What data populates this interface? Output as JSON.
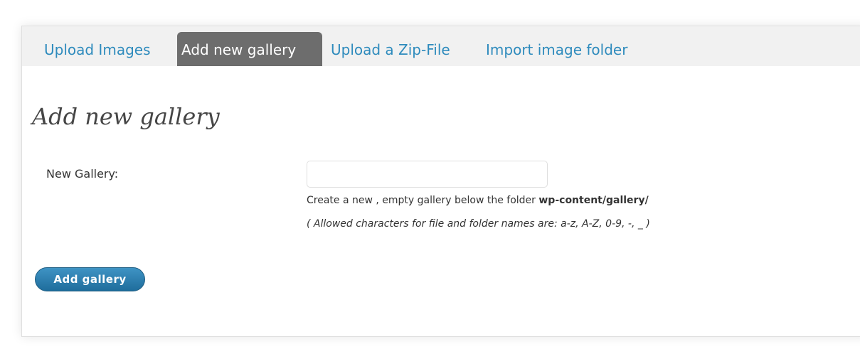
{
  "tabs": [
    {
      "label": "Upload Images",
      "active": false
    },
    {
      "label": "Add new gallery",
      "active": true
    },
    {
      "label": "Upload a Zip-File",
      "active": false
    },
    {
      "label": "Import image folder",
      "active": false
    }
  ],
  "page_title": "Add new gallery",
  "form": {
    "new_gallery_label": "New Gallery:",
    "new_gallery_value": "",
    "description_prefix": "Create a new , empty gallery below the folder ",
    "description_path": "wp-content/gallery/",
    "allowed_chars_note": "( Allowed characters for file and folder names are: a-z, A-Z, 0-9, -, _ )",
    "submit_label": "Add gallery"
  },
  "colors": {
    "link": "#2e8bbd",
    "active_tab_bg": "#6d6d6d",
    "button_bg": "#2572a3"
  }
}
